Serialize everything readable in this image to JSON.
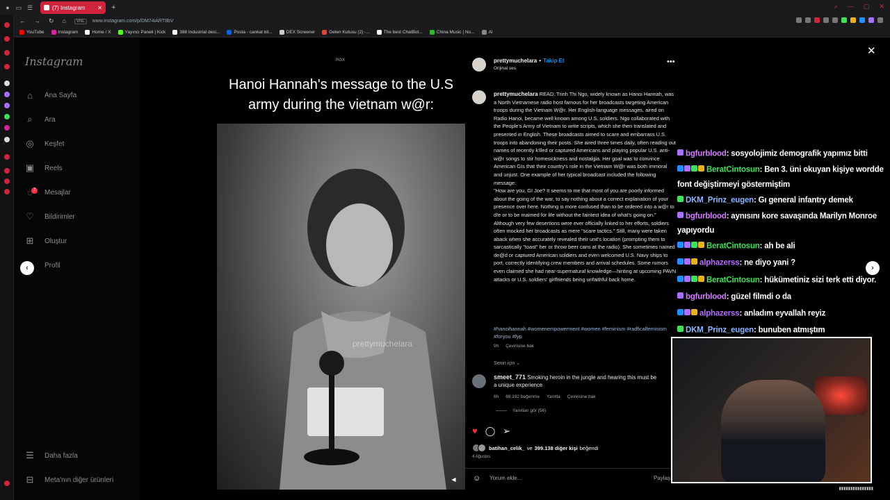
{
  "browser": {
    "tab_title": "(7) Instagram",
    "url": "www.instagram.com/p/DM74iART8bV",
    "url_badge": "VNL",
    "bookmarks": [
      {
        "label": "YouTube",
        "color": "#ff0000"
      },
      {
        "label": "Instagram",
        "color": "#d6249f"
      },
      {
        "label": "Home / X",
        "color": "#ffffff"
      },
      {
        "label": "Yayıncı Paneli | Kick",
        "color": "#53fc18"
      },
      {
        "label": "388 Industrial desi...",
        "color": "#ffffff"
      },
      {
        "label": "Posta - cankat bil...",
        "color": "#0a64d8"
      },
      {
        "label": "DEX Screener",
        "color": "#cccccc"
      },
      {
        "label": "Gelen Kutusu (2) -...",
        "color": "#ea4335"
      },
      {
        "label": "The best ChatBot...",
        "color": "#ffffff"
      },
      {
        "label": "China Music | No...",
        "color": "#2eb82e"
      },
      {
        "label": "AI",
        "color": "#888888"
      }
    ]
  },
  "sidebar": {
    "logo": "Instagram",
    "nav": [
      {
        "label": "Ana Sayfa",
        "icon": "home-icon"
      },
      {
        "label": "Ara",
        "icon": "search-icon"
      },
      {
        "label": "Keşfet",
        "icon": "compass-icon"
      },
      {
        "label": "Reels",
        "icon": "reels-icon"
      },
      {
        "label": "Mesajlar",
        "icon": "messenger-icon",
        "badge": "7"
      },
      {
        "label": "Bildirimler",
        "icon": "heart-icon"
      },
      {
        "label": "Oluştur",
        "icon": "plus-square-icon"
      },
      {
        "label": "Profil",
        "icon": "avatar-icon"
      }
    ],
    "more": "Daha fazla",
    "meta": "Meta'nın diğer ürünleri"
  },
  "post": {
    "video_tag": "RGX",
    "video_title": "Hanoi Hannah's message to the U.S army during the vietnam w@r:",
    "watermark": "prettymuchelara",
    "username": "prettymuchelara",
    "follow": "Takip Et",
    "audio": "Orijinal ses",
    "caption_user": "prettymuchelara",
    "caption": "READ: Trinh Thi Ngo, widely known as Hanoi Hannah, was a North Vietnamese radio host famous for her broadcasts targeting American troops during the Vietnam W@r. Her English-language messages, aired on Radio Hanoi, became well known among U.S. soldiers. Ngo collaborated with the People's Army of Vietnam to write scripts, which she then translated and presented in English. These broadcasts aimed to scare and embarrass U.S. troops into abandoning their posts. She aired three times daily, often reading out names of recently k!lled or captured Americans and playing popular U.S. anti-w@r songs to stir homesickness and nostalgia. Her goal was to convince American GIs that their country's role in the Vietnam W@r was both immoral and unjust. One example of her typical broadcast included the following message:\n\"How are you, GI Joe? It seems to me that most of you are poorly informed about the going of the war, to say nothing about a correct explanation of your presence over here. Nothing is more confused than to be ordered into a w@r to d!e or to be maimed for life without the faintest idea of what's going on.\"\nAlthough very few desertions were ever officially linked to her efforts, soldiers often mocked her broadcasts as mere \"scare tactics.\" Still, many were taken aback when she accurately revealed their unit's location (prompting them to sarcastically \"toast\" her or throw beer cans at the radio). She sometimes named de@d or captured American soldiers and even welcomed U.S. Navy ships to port, correctly identifying crew members and arrival schedules. Some rumors even claimed she had near-supernatural knowledge—hinting at upcoming PAVN attacks or U.S. soldiers' girlfriends being unfaithful back home.",
    "hashtags": "#hanoihannah #womenempowerment #women #feminism #radficalfeminism #foryou #fyp",
    "caption_age": "9h",
    "see_translation": "Çevirisine bak",
    "for_you": "Senin için",
    "comment": {
      "user": "smeet_771",
      "text": "Smoking heroin in the jungle and hearing this must be a unique experience",
      "age": "6h",
      "likes": "68.192 beğenme",
      "reply": "Yanıtla",
      "translate": "Çevirisine bak",
      "view_replies": "Yanıtları gör (56)"
    },
    "liked_by_user": "batihan_celik_",
    "liked_by_mid": "ve",
    "liked_by_count": "399.138 diğer kişi",
    "liked_by_suffix": "beğendi",
    "date": "4 Ağustos",
    "comment_placeholder": "Yorum ekle...",
    "share_label": "Paylaş"
  },
  "chat": [
    {
      "user": "bgfurblood",
      "color": "#d77bff",
      "text": ": sosyolojimiz demografik yapımız bitti",
      "badges": [
        "#a970ff"
      ]
    },
    {
      "user": "BeratCintosun",
      "color": "#3ee05c",
      "text": ": Ben 3. üni okuyan kişiye wordde font değiştirmeyi göstermiştim",
      "badges": [
        "#1e90ff",
        "#a970ff",
        "#3ee05c",
        "#e8b21b"
      ]
    },
    {
      "user": "DKM_Prinz_eugen",
      "color": "#8ab6ff",
      "text": ": Gı general infantry demek",
      "badges": [
        "#3ee05c"
      ]
    },
    {
      "user": "bgfurblood",
      "color": "#d77bff",
      "text": ": aynısını kore savaşında Marilyn Monroe yapıyordu",
      "badges": [
        "#a970ff"
      ]
    },
    {
      "user": "BeratCintosun",
      "color": "#3ee05c",
      "text": ": ah be ali",
      "badges": [
        "#1e90ff",
        "#a970ff",
        "#3ee05c",
        "#e8b21b"
      ]
    },
    {
      "user": "alphazerss",
      "color": "#b46cff",
      "text": ": ne diyo yani ?",
      "badges": [
        "#1e90ff",
        "#a970ff",
        "#e8b21b"
      ]
    },
    {
      "user": "BeratCintosun",
      "color": "#3ee05c",
      "text": ": hükümetiniz sizi terk etti diyor.",
      "badges": [
        "#1e90ff",
        "#a970ff",
        "#3ee05c",
        "#e8b21b"
      ]
    },
    {
      "user": "bgfurblood",
      "color": "#d77bff",
      "text": ": güzel filmdi o da",
      "badges": [
        "#a970ff"
      ]
    },
    {
      "user": "alphazerss",
      "color": "#b46cff",
      "text": ": anladım eyvallah reyiz",
      "badges": [
        "#1e90ff",
        "#a970ff",
        "#e8b21b"
      ]
    },
    {
      "user": "DKM_Prinz_eugen",
      "color": "#8ab6ff",
      "text": ": bunuben atmıştım",
      "badges": [
        "#3ee05c"
      ]
    }
  ]
}
